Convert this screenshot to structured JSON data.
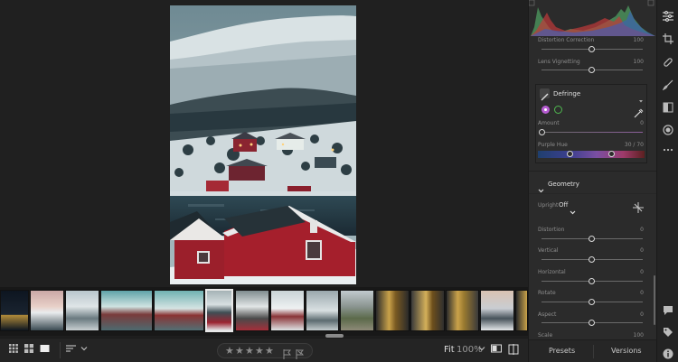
{
  "panel": {
    "distortion_correction_label": "Distortion Correction",
    "distortion_correction_value": "100",
    "lens_vignetting_label": "Lens Vignetting",
    "lens_vignetting_value": "100",
    "defringe_title": "Defringe",
    "amount_label": "Amount",
    "amount_value": "0",
    "purple_hue_label": "Purple Hue",
    "purple_hue_value": "30 / 70",
    "geometry_title": "Geometry",
    "upright_label": "Upright",
    "upright_value": "Off",
    "geometry_rows": [
      {
        "label": "Distortion",
        "value": "0"
      },
      {
        "label": "Vertical",
        "value": "0"
      },
      {
        "label": "Horizontal",
        "value": "0"
      },
      {
        "label": "Rotate",
        "value": "0"
      },
      {
        "label": "Aspect",
        "value": "0"
      },
      {
        "label": "Scale",
        "value": "100"
      }
    ],
    "presets_label": "Presets",
    "versions_label": "Versions"
  },
  "toolbar": {
    "fit_label": "Fit",
    "zoom_value": "100%",
    "stars": [
      "★",
      "★",
      "★",
      "★",
      "★"
    ]
  },
  "colors": {
    "accent_purple": "#b55bd0",
    "accent_green": "#4fb84f"
  },
  "icons": {
    "toolbar_left": [
      "grid-view-icon",
      "square-grid-icon",
      "single-view-icon",
      "sort-icon",
      "chevron-down-icon"
    ],
    "toolbar_right": [
      "chevron-down-icon",
      "before-after-icon",
      "compare-icon"
    ],
    "tools": [
      "edit-sliders-icon",
      "crop-icon",
      "healing-icon",
      "brush-icon",
      "linear-gradient-icon",
      "radial-gradient-icon",
      "more-icon",
      "comment-icon",
      "tag-icon",
      "info-icon"
    ]
  }
}
